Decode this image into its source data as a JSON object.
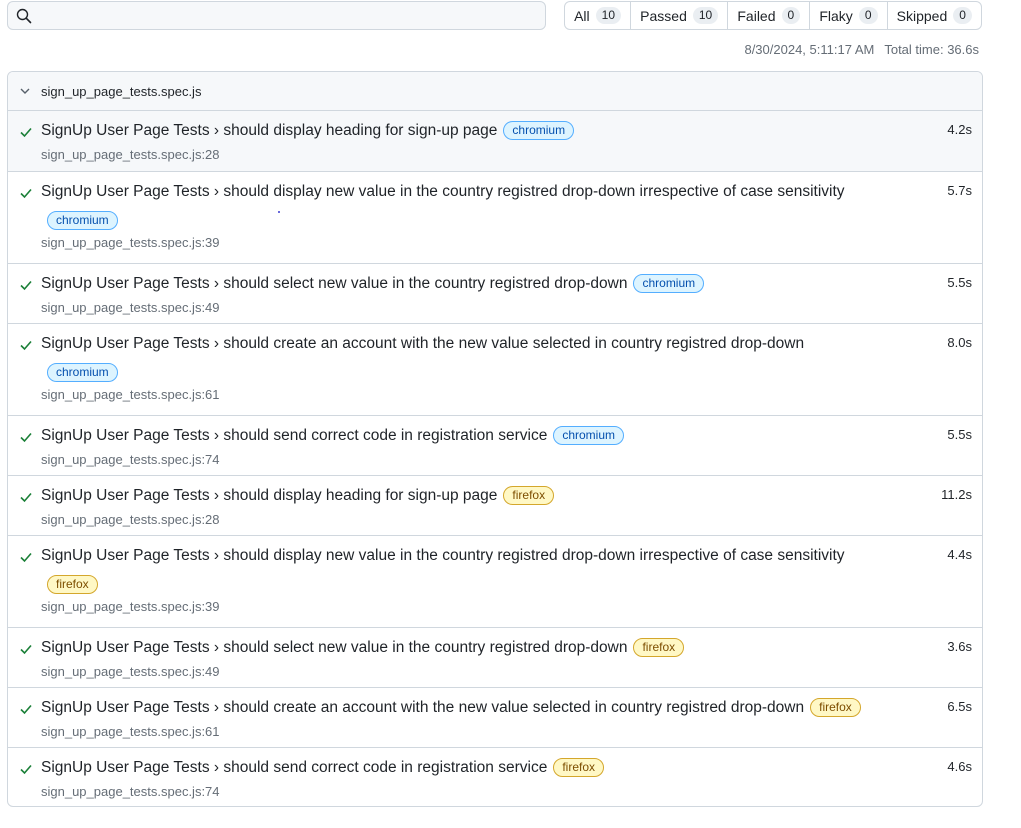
{
  "search": {
    "placeholder": "",
    "value": ""
  },
  "filters": [
    {
      "label": "All",
      "count": "10"
    },
    {
      "label": "Passed",
      "count": "10"
    },
    {
      "label": "Failed",
      "count": "0"
    },
    {
      "label": "Flaky",
      "count": "0"
    },
    {
      "label": "Skipped",
      "count": "0"
    }
  ],
  "meta": {
    "datetime": "8/30/2024, 5:11:17 AM",
    "total_time": "Total time: 36.6s"
  },
  "file": {
    "name": "sign_up_page_tests.spec.js"
  },
  "tests": [
    {
      "suite": "SignUp User Page Tests",
      "name": "should display heading for sign-up page",
      "project": "chromium",
      "location": "sign_up_page_tests.spec.js:28",
      "duration": "4.2s"
    },
    {
      "suite": "SignUp User Page Tests",
      "name": "should display new value in the country registred drop-down irrespective of case sensitivity",
      "project": "chromium",
      "location": "sign_up_page_tests.spec.js:39",
      "duration": "5.7s"
    },
    {
      "suite": "SignUp User Page Tests",
      "name": "should select new value in the country registred drop-down",
      "project": "chromium",
      "location": "sign_up_page_tests.spec.js:49",
      "duration": "5.5s"
    },
    {
      "suite": "SignUp User Page Tests",
      "name": "should create an account with the new value selected in country registred drop-down",
      "project": "chromium",
      "location": "sign_up_page_tests.spec.js:61",
      "duration": "8.0s"
    },
    {
      "suite": "SignUp User Page Tests",
      "name": "should send correct code in registration service",
      "project": "chromium",
      "location": "sign_up_page_tests.spec.js:74",
      "duration": "5.5s"
    },
    {
      "suite": "SignUp User Page Tests",
      "name": "should display heading for sign-up page",
      "project": "firefox",
      "location": "sign_up_page_tests.spec.js:28",
      "duration": "11.2s"
    },
    {
      "suite": "SignUp User Page Tests",
      "name": "should display new value in the country registred drop-down irrespective of case sensitivity",
      "project": "firefox",
      "location": "sign_up_page_tests.spec.js:39",
      "duration": "4.4s"
    },
    {
      "suite": "SignUp User Page Tests",
      "name": "should select new value in the country registred drop-down",
      "project": "firefox",
      "location": "sign_up_page_tests.spec.js:49",
      "duration": "3.6s"
    },
    {
      "suite": "SignUp User Page Tests",
      "name": "should create an account with the new value selected in country registred drop-down",
      "project": "firefox",
      "location": "sign_up_page_tests.spec.js:61",
      "duration": "6.5s"
    },
    {
      "suite": "SignUp User Page Tests",
      "name": "should send correct code in registration service",
      "project": "firefox",
      "location": "sign_up_page_tests.spec.js:74",
      "duration": "4.6s"
    }
  ],
  "separator": "›",
  "colors": {
    "pass": "#1a7f37",
    "chromium_bg": "#ddf4ff",
    "firefox_bg": "#fff8c5",
    "border": "#d0d7de"
  },
  "icons": {
    "search": "search-icon",
    "chevron": "chevron-down-icon",
    "status": "check-icon"
  }
}
